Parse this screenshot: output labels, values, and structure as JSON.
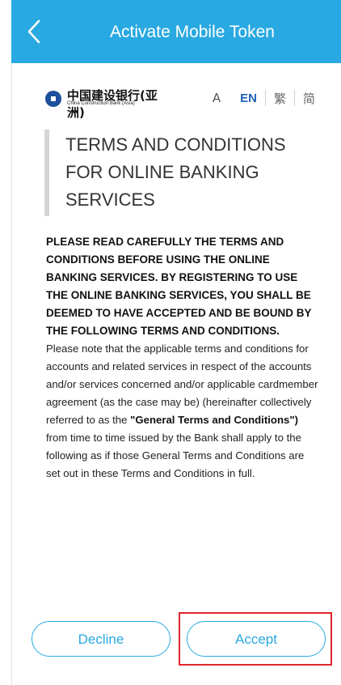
{
  "header": {
    "title": "Activate Mobile Token"
  },
  "brand": {
    "chinese_name": "中国建设银行(亚洲)",
    "english_name": "China Construction Bank (Asia)"
  },
  "language": {
    "font_size_icon": "A",
    "options": [
      "EN",
      "繁",
      "简"
    ],
    "selected": "EN"
  },
  "terms": {
    "title": "TERMS AND CONDITIONS FOR ONLINE BANKING SERVICES",
    "notice": "PLEASE READ CAREFULLY THE TERMS AND CONDITIONS BEFORE USING THE ONLINE BANKING SERVICES. BY REGISTERING TO USE THE ONLINE BANKING SERVICES, YOU SHALL BE DEEMED TO HAVE ACCEPTED AND BE BOUND BY THE FOLLOWING TERMS AND CONDITIONS.",
    "body_part1": "Please note that the applicable terms and conditions for accounts and related services in respect of the accounts and/or services concerned and/or applicable cardmember agreement (as the case may be) (hereinafter collectively referred to as the ",
    "body_bold": "\"General Terms and Conditions\")",
    "body_part2": " from time to time issued by the Bank shall apply to the following as if those General Terms and Conditions are set out in these Terms and Conditions in full."
  },
  "actions": {
    "decline_label": "Decline",
    "accept_label": "Accept"
  },
  "colors": {
    "header_bg": "#29a9e1",
    "accent": "#29a9e1",
    "active_lang": "#1d5fb4",
    "highlight": "#e0252b"
  }
}
